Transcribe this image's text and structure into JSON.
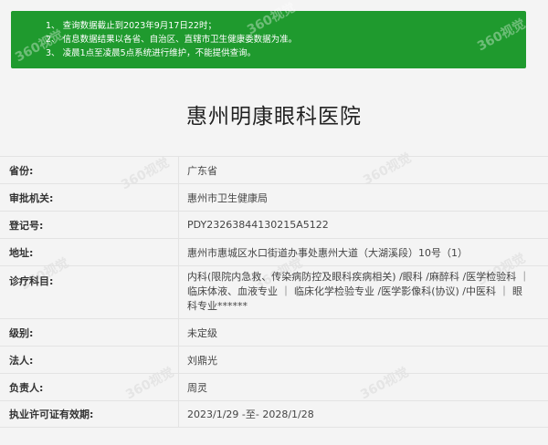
{
  "notice": {
    "lines": [
      "1、 查询数据截止到2023年9月17日22时；",
      "2、 信息数据结果以各省、自治区、直辖市卫生健康委数据为准。",
      "3、 凌晨1点至凌晨5点系统进行维护，不能提供查询。"
    ]
  },
  "watermark": "360视觉",
  "hospital_name": "惠州明康眼科医院",
  "fields": {
    "province_label": "省份:",
    "province_value": "广东省",
    "approval_label": "审批机关:",
    "approval_value": "惠州市卫生健康局",
    "reg_label": "登记号:",
    "reg_value": "PDY23263844130215A5122",
    "address_label": "地址:",
    "address_value": "惠州市惠城区水口街道办事处惠州大道（大湖溪段）10号（1）",
    "subjects_label": "诊疗科目:",
    "subjects_value": "内科(限院内急救、传染病防控及眼科疾病相关) /眼科 /麻醉科 /医学检验科 ｜ 临床体液、血液专业 ｜ 临床化学检验专业 /医学影像科(协议) /中医科 ｜ 眼科专业******",
    "level_label": "级别:",
    "level_value": "未定级",
    "legal_label": "法人:",
    "legal_value": "刘鼎光",
    "person_label": "负责人:",
    "person_value": "周灵",
    "validity_label": "执业许可证有效期:",
    "validity_value": "2023/1/29 -至- 2028/1/28"
  }
}
